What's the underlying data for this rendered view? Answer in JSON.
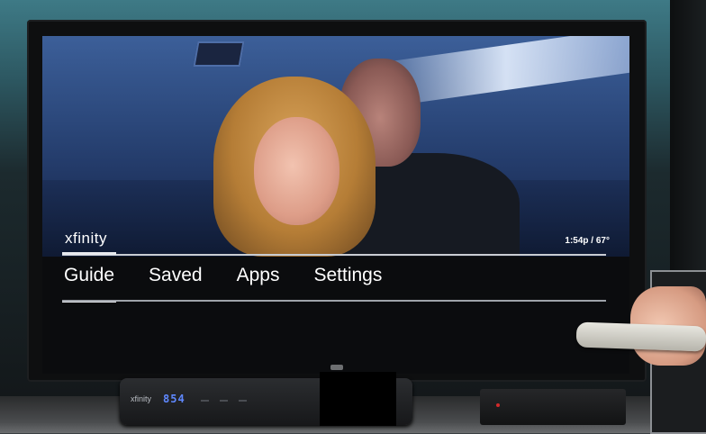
{
  "tv": {
    "brand_logo": "xfinity",
    "clock_temp": "1:54p / 67°",
    "menu": {
      "items": [
        {
          "label": "Guide",
          "active": true
        },
        {
          "label": "Saved",
          "active": false
        },
        {
          "label": "Apps",
          "active": false
        },
        {
          "label": "Settings",
          "active": false
        }
      ]
    }
  },
  "cable_box": {
    "logo": "xfinity",
    "display": "854"
  },
  "colors": {
    "menu_text": "#ffffff",
    "underline": "#e8eaee",
    "box_display": "#5f88ff"
  }
}
